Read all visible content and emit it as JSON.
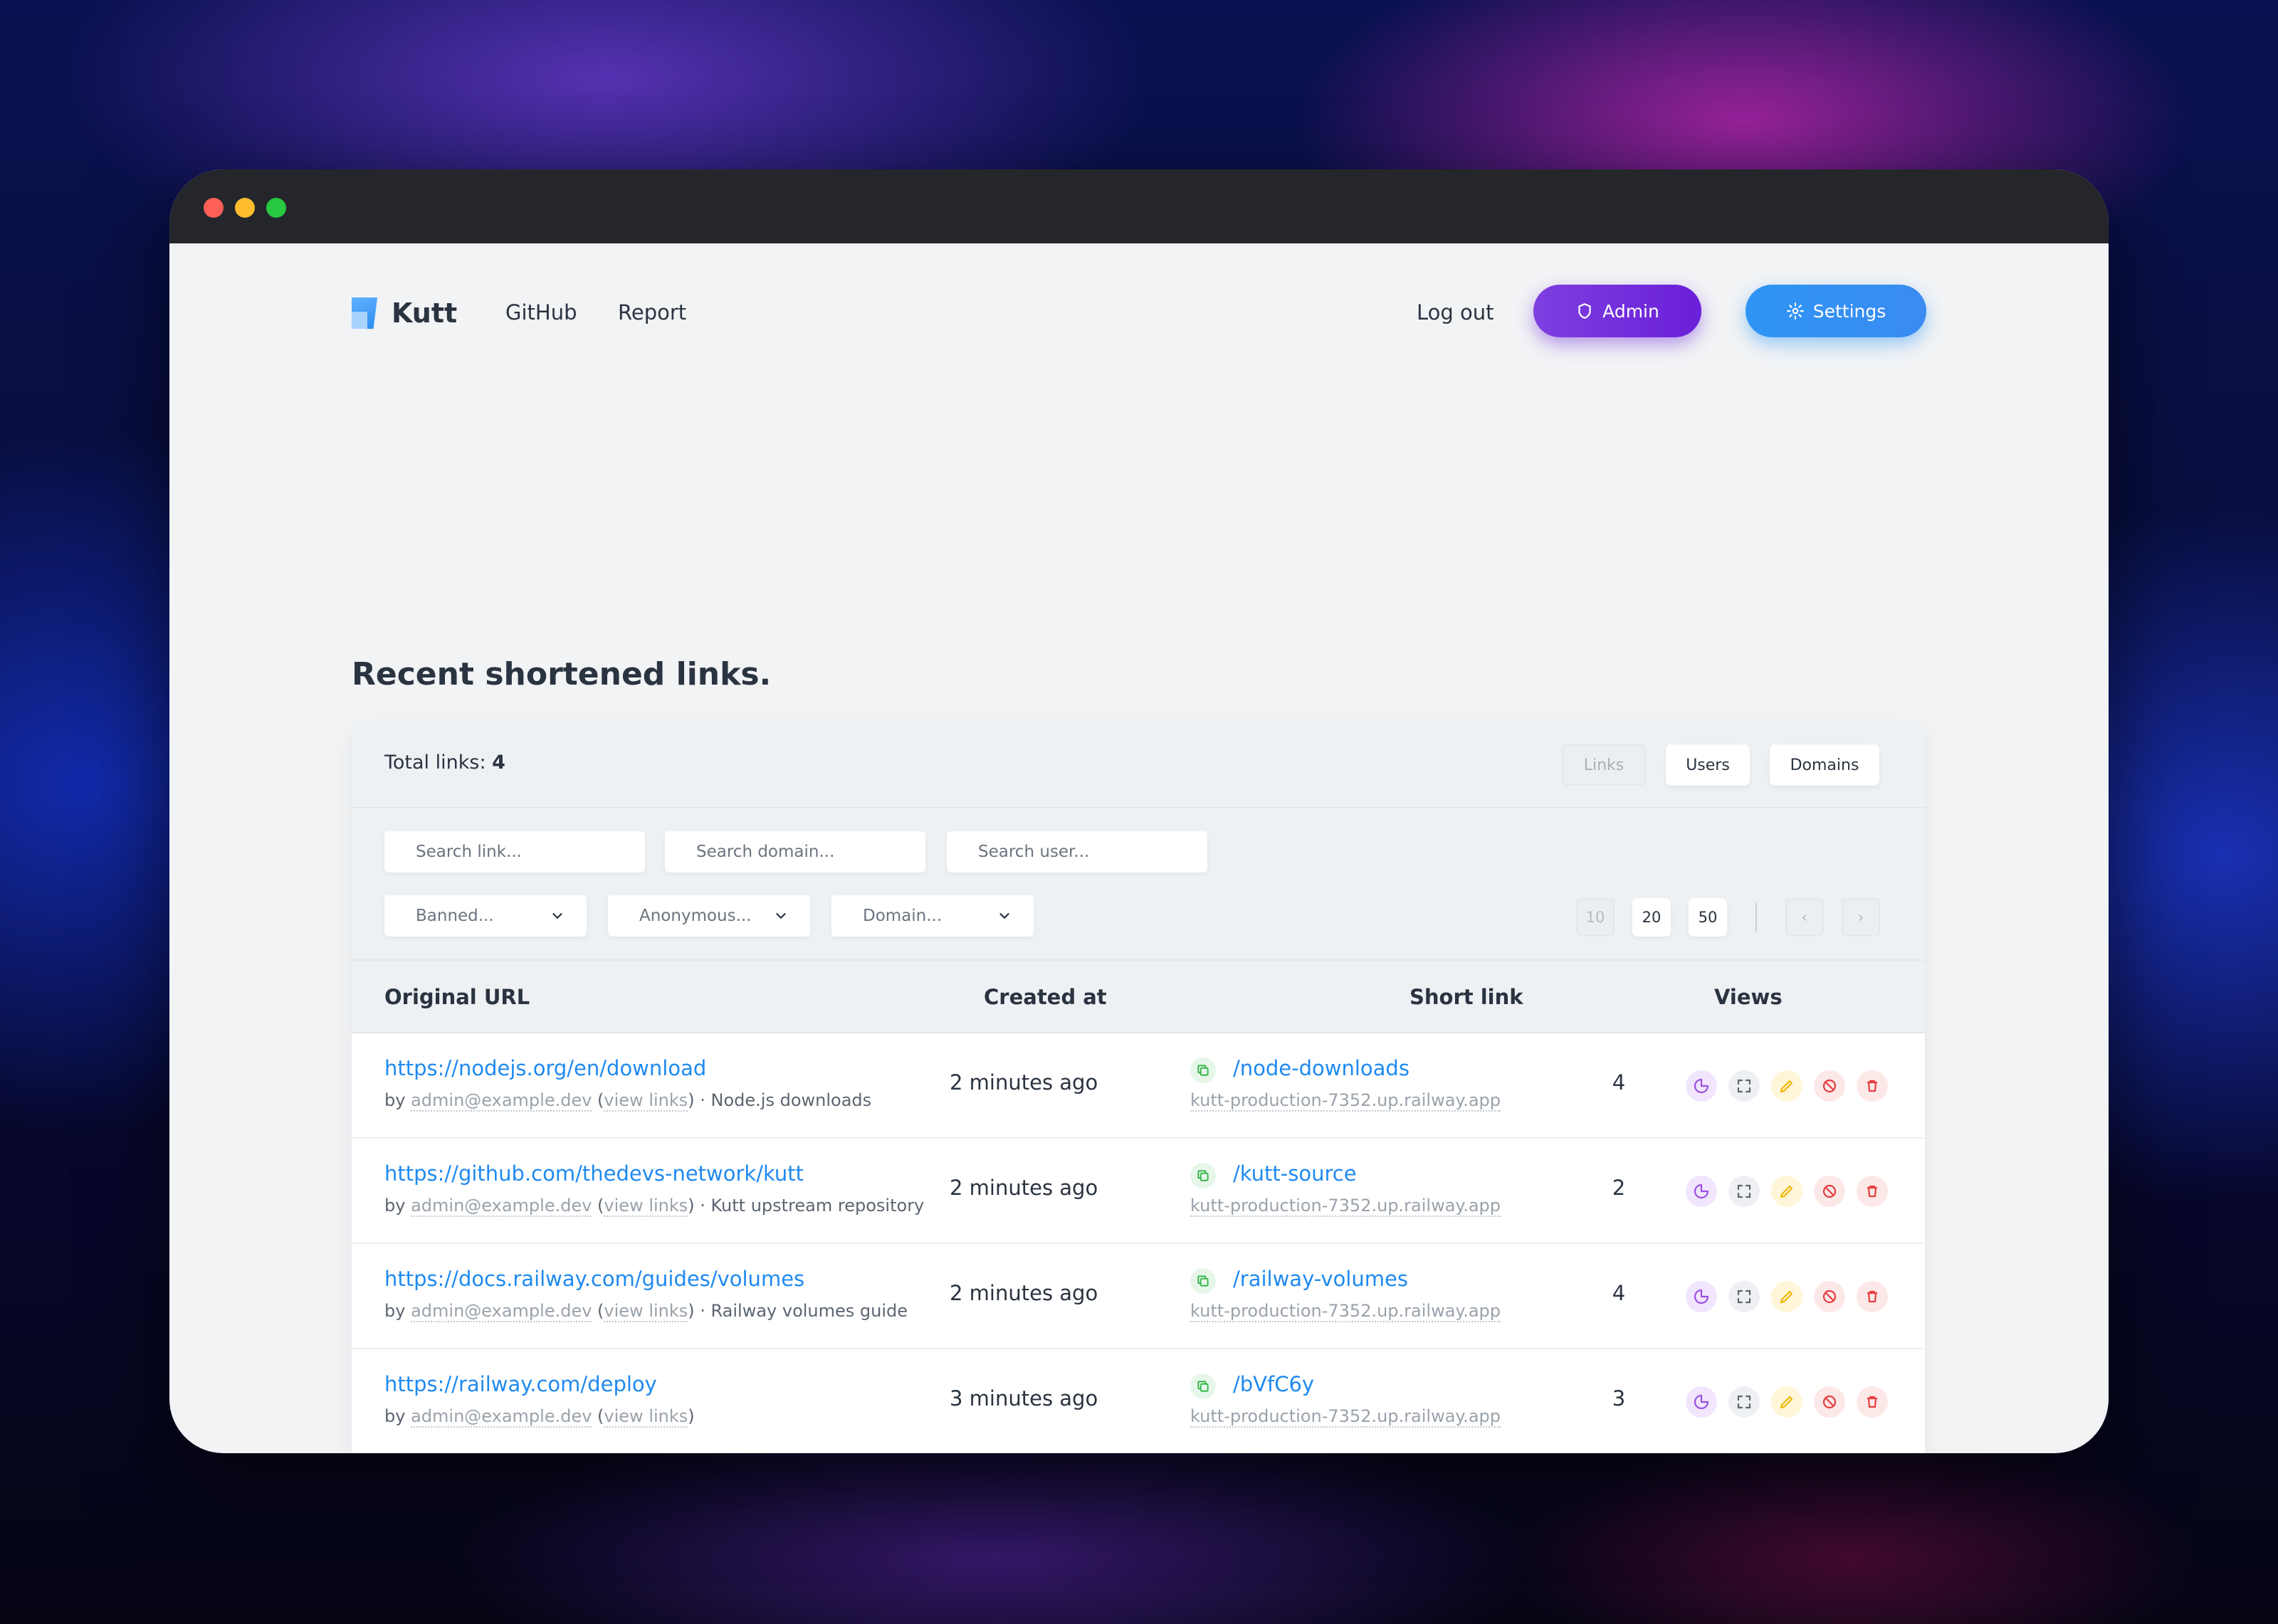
{
  "brand": {
    "name": "Kutt"
  },
  "nav": {
    "github": "GitHub",
    "report": "Report",
    "logout": "Log out"
  },
  "buttons": {
    "admin": "Admin",
    "settings": "Settings"
  },
  "page": {
    "title": "Recent shortened links."
  },
  "panel": {
    "total_label": "Total links:",
    "total_value": "4",
    "tabs": {
      "links": "Links",
      "users": "Users",
      "domains": "Domains"
    }
  },
  "filters": {
    "search_link": "Search link...",
    "search_domain": "Search domain...",
    "search_user": "Search user...",
    "banned": "Banned...",
    "anonymous": "Anonymous...",
    "domain": "Domain..."
  },
  "pagination": {
    "sizes": [
      "10",
      "20",
      "50"
    ],
    "prev": "‹",
    "next": "›"
  },
  "table": {
    "headers": {
      "original_url": "Original URL",
      "created_at": "Created at",
      "short_link": "Short link",
      "views": "Views"
    },
    "rows": [
      {
        "url": "https://nodejs.org/en/download",
        "by": "by",
        "user": "admin@example.dev",
        "view_links": "view links",
        "description": "Node.js downloads",
        "created": "2 minutes ago",
        "short": "/node-downloads",
        "domain": "kutt-production-7352.up.railway.app",
        "views": "4"
      },
      {
        "url": "https://github.com/thedevs-network/kutt",
        "by": "by",
        "user": "admin@example.dev",
        "view_links": "view links",
        "description": "Kutt upstream repository",
        "created": "2 minutes ago",
        "short": "/kutt-source",
        "domain": "kutt-production-7352.up.railway.app",
        "views": "2"
      },
      {
        "url": "https://docs.railway.com/guides/volumes",
        "by": "by",
        "user": "admin@example.dev",
        "view_links": "view links",
        "description": "Railway volumes guide",
        "created": "2 minutes ago",
        "short": "/railway-volumes",
        "domain": "kutt-production-7352.up.railway.app",
        "views": "4"
      },
      {
        "url": "https://railway.com/deploy",
        "by": "by",
        "user": "admin@example.dev",
        "view_links": "view links",
        "description": "",
        "created": "3 minutes ago",
        "short": "/bVfC6y",
        "domain": "kutt-production-7352.up.railway.app",
        "views": "3"
      }
    ]
  },
  "colors": {
    "admin": "#6f29d9",
    "settings": "#2f95f5",
    "link": "#1f8af0",
    "stats": "#9b51e0",
    "edit": "#f2b705",
    "ban": "#e53e3e",
    "copy": "#2fb344"
  },
  "icons": [
    "shield-icon",
    "gear-icon",
    "chevron-down-icon",
    "copy-icon",
    "stats-icon",
    "qr-code-icon",
    "pencil-icon",
    "ban-icon",
    "trash-icon"
  ]
}
